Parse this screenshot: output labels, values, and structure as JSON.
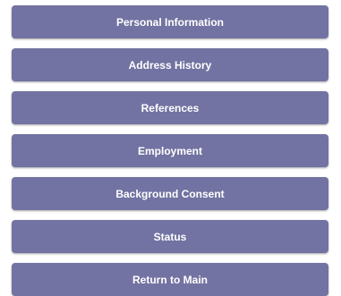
{
  "menu": {
    "items": [
      {
        "label": "Personal Information"
      },
      {
        "label": "Address History"
      },
      {
        "label": "References"
      },
      {
        "label": "Employment"
      },
      {
        "label": "Background Consent"
      },
      {
        "label": "Status"
      },
      {
        "label": "Return to Main"
      }
    ]
  },
  "colors": {
    "button_background": "#7273a2",
    "button_text": "#ffffff",
    "page_background": "#ffffff"
  }
}
